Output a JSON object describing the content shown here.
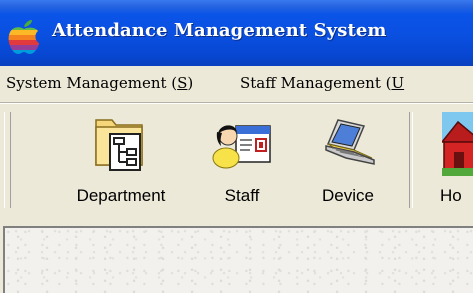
{
  "window": {
    "title": "Attendance Management System",
    "icon": "apple-logo-icon"
  },
  "menu": {
    "items": [
      {
        "prefix": "System Management (",
        "accel": "S",
        "suffix": ")"
      },
      {
        "prefix": "Staff Management (",
        "accel": "U",
        "suffix": ""
      }
    ]
  },
  "toolbar": {
    "buttons": [
      {
        "label": "Department",
        "icon": "department-tree-icon"
      },
      {
        "label": "Staff",
        "icon": "staff-card-icon"
      },
      {
        "label": "Device",
        "icon": "laptop-device-icon"
      },
      {
        "label": "Ho",
        "icon": "holiday-house-icon"
      }
    ]
  },
  "colors": {
    "titlebar": "#0a54e8",
    "face": "#ece9d8"
  }
}
